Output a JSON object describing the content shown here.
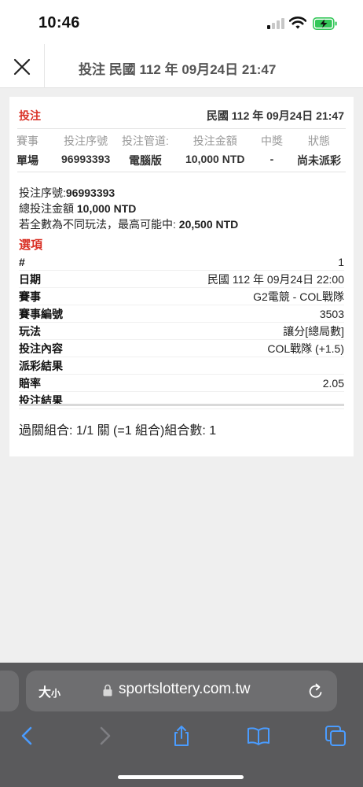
{
  "status_bar": {
    "time": "10:46"
  },
  "header": {
    "title": "投注 民國 112 年 09月24日 21:47"
  },
  "summary": {
    "title": "投注",
    "datetime": "民國 112 年 09月24日 21:47",
    "columns": [
      {
        "header": "賽事",
        "value": "單場"
      },
      {
        "header": "投注序號",
        "value": "96993393"
      },
      {
        "header": "投注管道:",
        "value": "電腦版"
      },
      {
        "header": "投注金額",
        "value": "10,000 NTD"
      },
      {
        "header": "中獎",
        "value": "-"
      },
      {
        "header": "狀態",
        "value": "尚未派彩"
      }
    ]
  },
  "info": {
    "serial_label": "投注序號:",
    "serial_value": "96993393",
    "amount_label": "總投注金額 ",
    "amount_value": "10,000 NTD",
    "max_label": "若全數為不同玩法，最高可能中: ",
    "max_value": "20,500 NTD"
  },
  "options": {
    "title": "選項",
    "rows": [
      {
        "label": "#",
        "value": "1"
      },
      {
        "label": "日期",
        "value": "民國 112 年 09月24日 22:00"
      },
      {
        "label": "賽事",
        "value": "G2電競 - COL戰隊"
      },
      {
        "label": "賽事編號",
        "value": "3503"
      },
      {
        "label": "玩法",
        "value": "讓分[總局數]"
      },
      {
        "label": "投注內容",
        "value": "COL戰隊 (+1.5)"
      },
      {
        "label": "派彩結果",
        "value": ""
      },
      {
        "label": "賠率",
        "value": "2.05"
      },
      {
        "label": "投注結果",
        "value": ""
      }
    ]
  },
  "parlay": "過關組合: 1/1 關 (=1 組合)組合數: 1",
  "browser": {
    "text_size_big": "大",
    "text_size_small": "小",
    "url": "sportslottery.com.tw",
    "toolbar_icons": [
      "back-icon",
      "forward-icon",
      "share-icon",
      "bookmarks-icon",
      "tabs-icon"
    ]
  }
}
